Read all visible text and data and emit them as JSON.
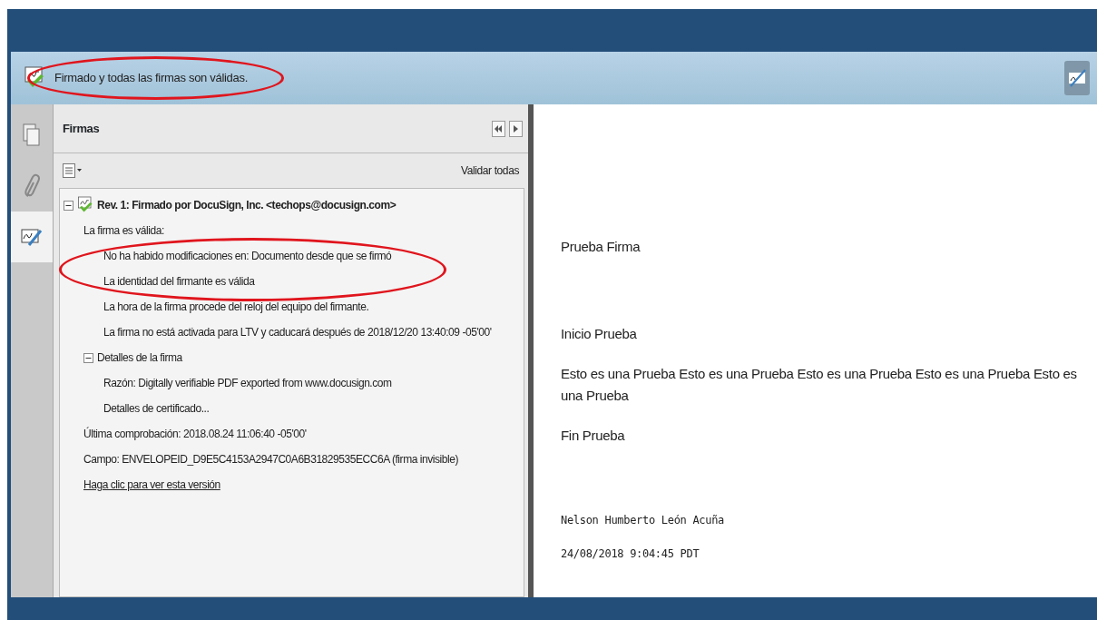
{
  "message_bar": {
    "text": "Firmado y todas las firmas son válidas.",
    "circled": true
  },
  "side_tabs": [
    {
      "kind": "pages",
      "selected": false
    },
    {
      "kind": "attachments",
      "selected": false
    },
    {
      "kind": "signatures",
      "selected": true
    }
  ],
  "panel": {
    "title": "Firmas",
    "validate_all": "Validar todas",
    "tree": [
      {
        "kind": "signature",
        "text": "Rev. 1: Firmado por DocuSign, Inc. <techops@docusign.com>",
        "expanded": true,
        "children": [
          {
            "kind": "text",
            "text": "La firma es válida:",
            "children": [
              {
                "kind": "text",
                "text": "No ha habido modificaciones en: Documento desde que se firmó",
                "circled": true
              },
              {
                "kind": "text",
                "text": "La identidad del firmante es válida",
                "circled": true
              },
              {
                "kind": "text",
                "text": "La hora de la firma procede del reloj del equipo del firmante."
              },
              {
                "kind": "text",
                "text": "La firma no está activada para LTV y caducará después de 2018/12/20 13:40:09 -05'00'"
              }
            ]
          },
          {
            "kind": "text",
            "text": "Detalles de la firma",
            "expanded": true,
            "children": [
              {
                "kind": "text",
                "text": "Razón: Digitally verifiable PDF exported from www.docusign.com"
              },
              {
                "kind": "text",
                "text": "Detalles de certificado..."
              }
            ]
          },
          {
            "kind": "text",
            "text": "Última comprobación: 2018.08.24 11:06:40 -05'00'"
          },
          {
            "kind": "text",
            "text": "Campo: ENVELOPEID_D9E5C4153A2947C0A6B31829535ECC6A (firma invisible)"
          },
          {
            "kind": "link",
            "text": "Haga clic para ver esta versión"
          }
        ]
      }
    ]
  },
  "document": [
    {
      "kind": "text",
      "text": "Prueba Firma"
    },
    {
      "kind": "gap"
    },
    {
      "kind": "text",
      "text": "Inicio Prueba"
    },
    {
      "kind": "text",
      "text": "Esto es una Prueba Esto es una Prueba Esto es una Prueba Esto es una Prueba Esto es una Prueba"
    },
    {
      "kind": "text",
      "text": "Fin Prueba"
    },
    {
      "kind": "gap"
    },
    {
      "kind": "mono",
      "text": "Nelson Humberto León Acuña"
    },
    {
      "kind": "mono",
      "text": "24/08/2018 9:04:45 PDT"
    }
  ]
}
